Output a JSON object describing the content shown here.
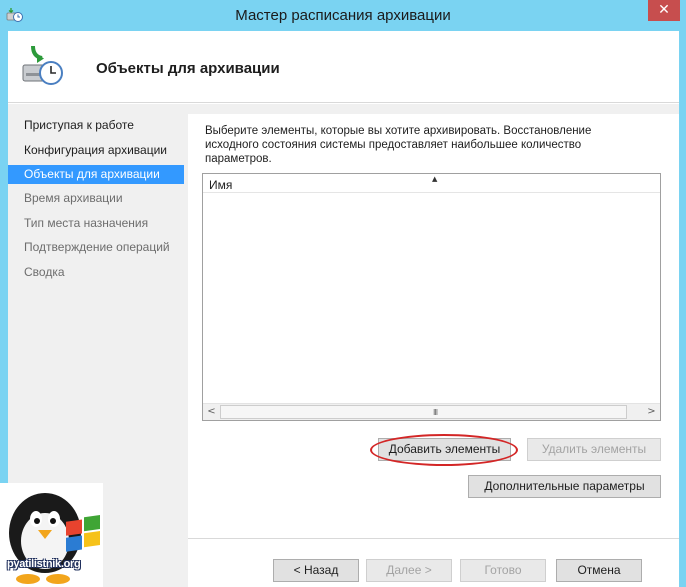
{
  "window": {
    "title": "Мастер расписания архивации",
    "close_glyph": "✕"
  },
  "header": {
    "title": "Объекты для архивации",
    "icon": "backup-schedule-icon"
  },
  "nav": {
    "items": [
      {
        "label": "Приступая к работе",
        "state": "normal"
      },
      {
        "label": "Конфигурация архивации",
        "state": "normal"
      },
      {
        "label": "Объекты для архивации",
        "state": "active"
      },
      {
        "label": "Время архивации",
        "state": "dim"
      },
      {
        "label": "Тип места назначения",
        "state": "dim"
      },
      {
        "label": "Подтверждение операций",
        "state": "dim"
      },
      {
        "label": "Сводка",
        "state": "dim"
      }
    ]
  },
  "content": {
    "description": "Выберите элементы, которые вы хотите архивировать. Восстановление исходного состояния системы предоставляет наибольшее количество параметров.",
    "list": {
      "column_name": "Имя",
      "sort_glyph": "▲",
      "scroll_left_glyph": "<",
      "scroll_right_glyph": ">",
      "scroll_grip": "III"
    },
    "add_button": "Добавить элементы",
    "remove_button": "Удалить элементы",
    "advanced_button": "Дополнительные параметры"
  },
  "footer": {
    "back_button": "< Назад",
    "next_button": "Далее >",
    "finish_button": "Готово",
    "cancel_button": "Отмена"
  },
  "watermark": {
    "text": "pyatilistnik.org"
  },
  "colors": {
    "titlebar": "#7ad3f2",
    "nav_active": "#3399ff",
    "close": "#c74e4e",
    "highlight": "#d32626"
  }
}
